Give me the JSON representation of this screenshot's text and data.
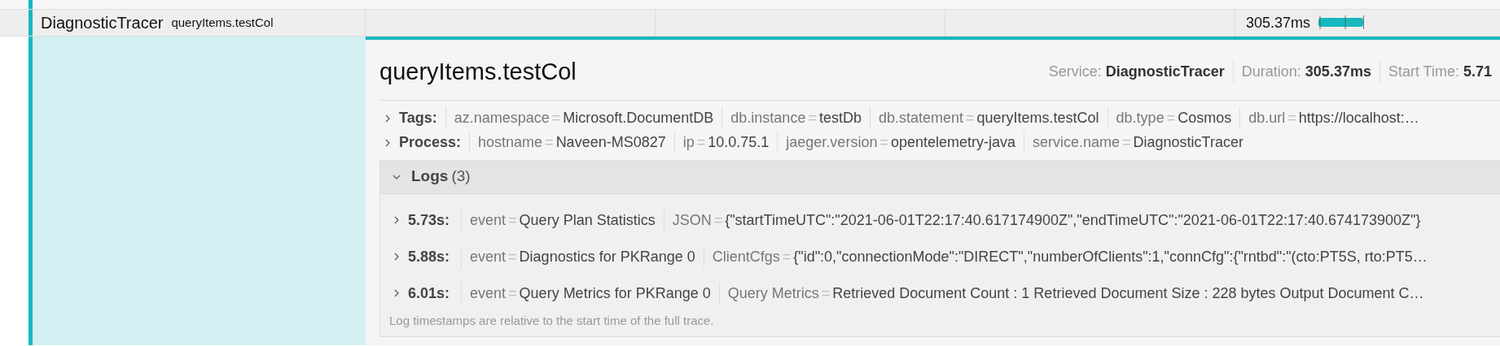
{
  "span_row": {
    "service": "DiagnosticTracer",
    "operation": "queryItems.testCol",
    "duration": "305.37ms"
  },
  "detail": {
    "title": "queryItems.testCol",
    "meta": [
      {
        "label": "Service:",
        "value": "DiagnosticTracer"
      },
      {
        "label": "Duration:",
        "value": "305.37ms"
      },
      {
        "label": "Start Time:",
        "value": "5.71"
      }
    ],
    "sections": [
      {
        "label": "Tags:",
        "expanded": false,
        "items": [
          {
            "key": "az.namespace",
            "eq": "=",
            "value": "Microsoft.DocumentDB"
          },
          {
            "key": "db.instance",
            "eq": "=",
            "value": "testDb"
          },
          {
            "key": "db.statement",
            "eq": "=",
            "value": "queryItems.testCol"
          },
          {
            "key": "db.type",
            "eq": "=",
            "value": "Cosmos"
          },
          {
            "key": "db.url",
            "eq": "=",
            "value": "https://localhost:…"
          }
        ]
      },
      {
        "label": "Process:",
        "expanded": false,
        "items": [
          {
            "key": "hostname",
            "eq": "=",
            "value": "Naveen-MS0827"
          },
          {
            "key": "ip",
            "eq": "=",
            "value": "10.0.75.1"
          },
          {
            "key": "jaeger.version",
            "eq": "=",
            "value": "opentelemetry-java"
          },
          {
            "key": "service.name",
            "eq": "=",
            "value": "DiagnosticTracer"
          }
        ]
      }
    ],
    "logs": {
      "label": "Logs",
      "count": "(3)",
      "expanded": true,
      "entries": [
        {
          "time": "5.73s:",
          "expanded": false,
          "fields": [
            {
              "key": "event",
              "eq": "=",
              "value": "Query Plan Statistics"
            },
            {
              "key": "JSON",
              "eq": "=",
              "value": "{\"startTimeUTC\":\"2021-06-01T22:17:40.617174900Z\",\"endTimeUTC\":\"2021-06-01T22:17:40.674173900Z\"}"
            }
          ]
        },
        {
          "time": "5.88s:",
          "expanded": false,
          "fields": [
            {
              "key": "event",
              "eq": "=",
              "value": "Diagnostics for PKRange 0"
            },
            {
              "key": "ClientCfgs",
              "eq": "=",
              "value": "{\"id\":0,\"connectionMode\":\"DIRECT\",\"numberOfClients\":1,\"connCfg\":{\"rntbd\":\"(cto:PT5S, rto:PT5…"
            }
          ]
        },
        {
          "time": "6.01s:",
          "expanded": false,
          "fields": [
            {
              "key": "event",
              "eq": "=",
              "value": "Query Metrics for PKRange 0"
            },
            {
              "key": "Query Metrics",
              "eq": "=",
              "value": "Retrieved Document Count : 1 Retrieved Document Size : 228 bytes Output Document C…"
            }
          ]
        }
      ],
      "note": "Log timestamps are relative to the start time of the full trace."
    }
  }
}
